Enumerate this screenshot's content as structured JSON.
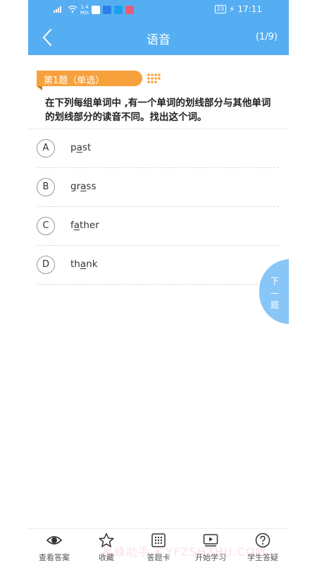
{
  "status_bar": {
    "network_speed_value": "1.4",
    "network_speed_unit": "M/s",
    "battery": "23",
    "time": "17:11"
  },
  "header": {
    "title": "语音",
    "counter": "(1/9)",
    "back_icon": "chevron-left-icon",
    "color": "#56aef2"
  },
  "question": {
    "type_label": "第1题（单选）",
    "text": "在下列每组单词中 ,有一个单词的划线部分与其他单词的划线部分的读音不同。找出这个词。",
    "accent_color": "#f7a13c"
  },
  "options": [
    {
      "letter": "A",
      "pre": "p",
      "under": "a",
      "post": "st"
    },
    {
      "letter": "B",
      "pre": "gr",
      "under": "a",
      "post": "ss"
    },
    {
      "letter": "C",
      "pre": "f",
      "under": "a",
      "post": "ther"
    },
    {
      "letter": "D",
      "pre": "th",
      "under": "a",
      "post": "nk"
    }
  ],
  "next_button": {
    "chars": [
      "下",
      "一",
      "题"
    ],
    "color": "#88c6f7"
  },
  "bottom_tabs": [
    {
      "label": "查看答案",
      "icon": "eye-icon"
    },
    {
      "label": "收藏",
      "icon": "star-icon"
    },
    {
      "label": "答题卡",
      "icon": "grid-card-icon"
    },
    {
      "label": "开始学习",
      "icon": "play-video-icon"
    },
    {
      "label": "学生答疑",
      "icon": "question-mark-icon"
    }
  ],
  "watermark": "易蜂助手 • YFZSHZHU.COM"
}
